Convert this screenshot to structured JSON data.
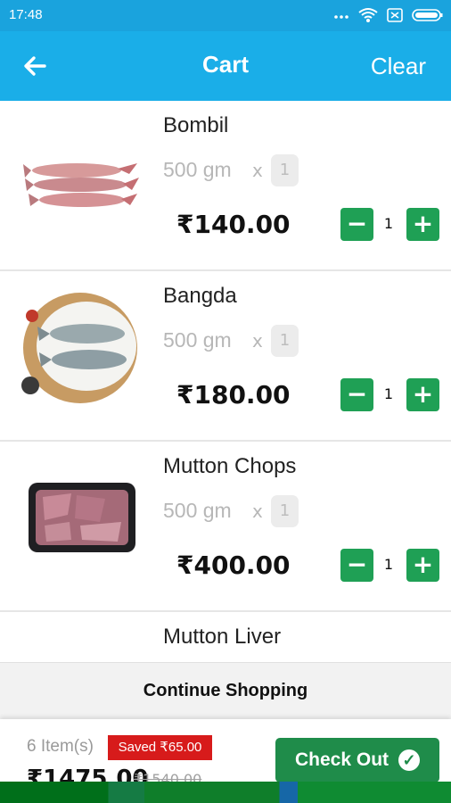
{
  "status_bar": {
    "time": "17:48"
  },
  "app_bar": {
    "title": "Cart",
    "clear_label": "Clear"
  },
  "items": [
    {
      "name": "Bombil",
      "unit": "500 gm",
      "x": "x",
      "unit_count": "1",
      "price": "₹140.00",
      "quantity": "1"
    },
    {
      "name": "Bangda",
      "unit": "500 gm",
      "x": "x",
      "unit_count": "1",
      "price": "₹180.00",
      "quantity": "1"
    },
    {
      "name": "Mutton Chops",
      "unit": "500 gm",
      "x": "x",
      "unit_count": "1",
      "price": "₹400.00",
      "quantity": "1"
    },
    {
      "name": "Mutton Liver"
    }
  ],
  "continue_shopping": "Continue Shopping",
  "footer": {
    "items_count": "6 Item(s)",
    "saved": "Saved ₹65.00",
    "total": "₹1475.00",
    "old_total": "₹1540.00",
    "checkout_label": "Check Out"
  },
  "colors": {
    "accent": "#1aaee8",
    "green": "#1fa055",
    "saved_red": "#d71b1b"
  }
}
